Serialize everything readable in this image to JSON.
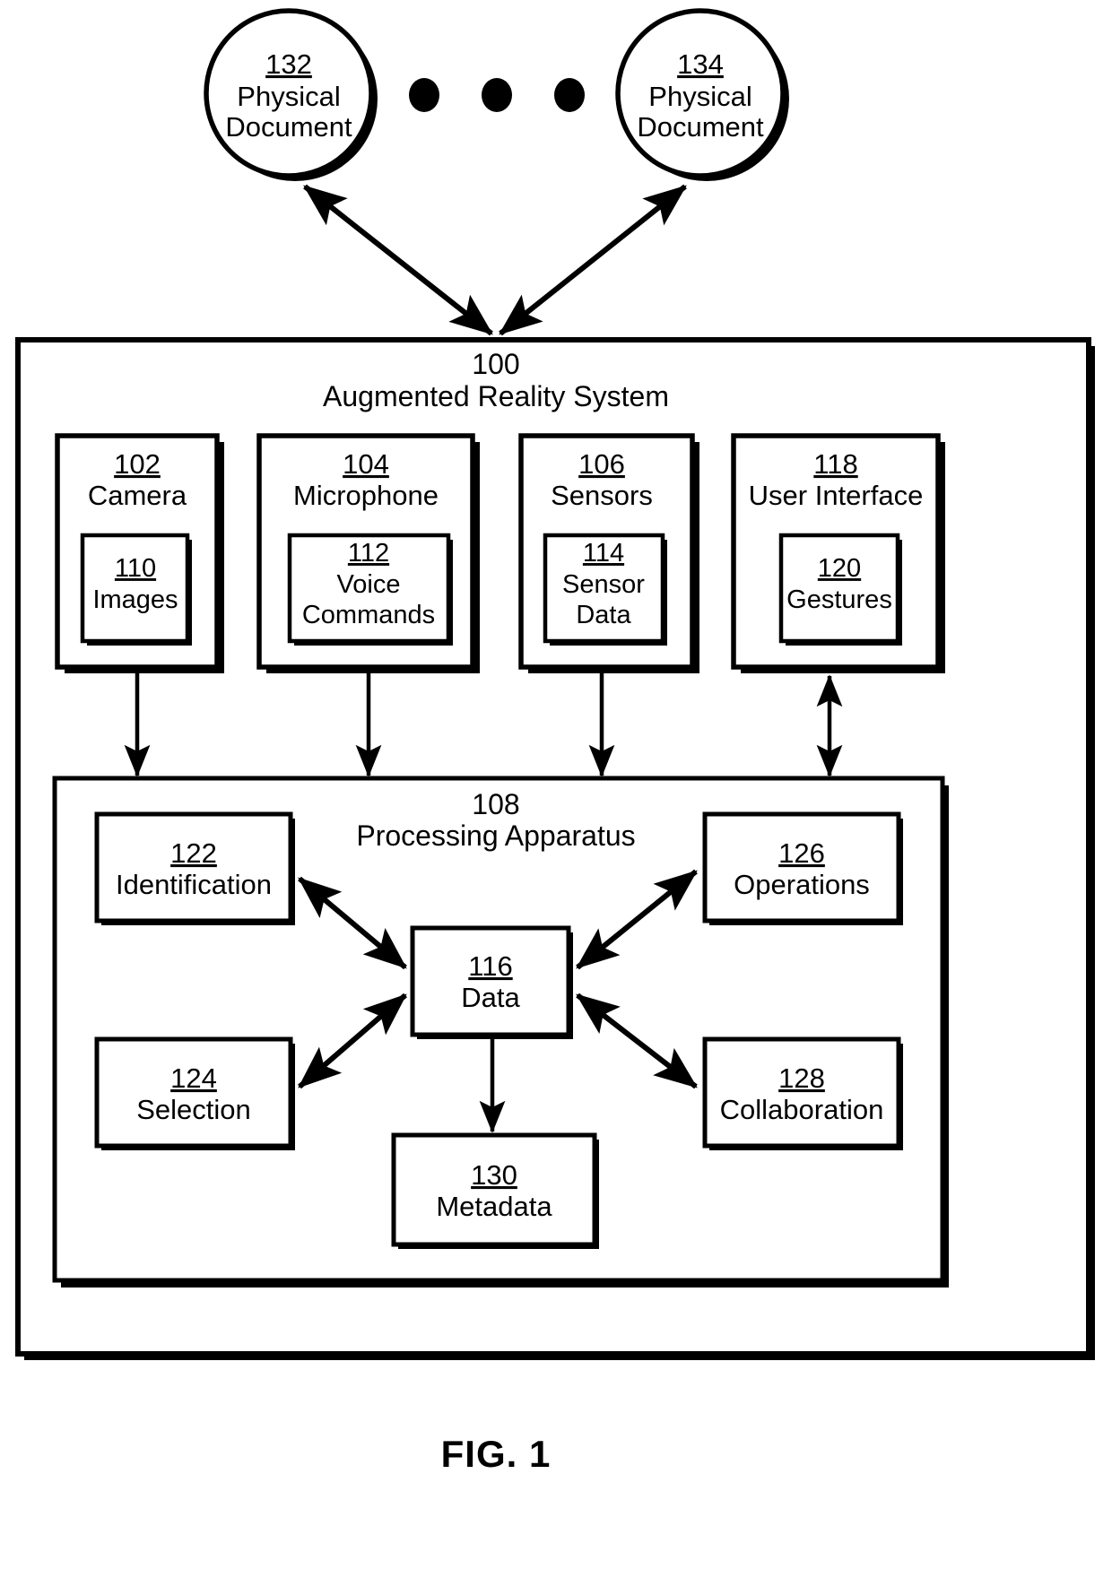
{
  "figure": {
    "caption": "FIG. 1",
    "title_ref": "100",
    "title_label": "Augmented Reality System"
  },
  "documents": [
    {
      "ref": "132",
      "line1": "Physical",
      "line2": "Document"
    },
    {
      "ref": "134",
      "line1": "Physical",
      "line2": "Document"
    }
  ],
  "ellipsis_dots": 3,
  "inputs": [
    {
      "ref": "102",
      "label": "Camera",
      "inner": {
        "ref": "110",
        "line1": "Images",
        "line2": ""
      }
    },
    {
      "ref": "104",
      "label": "Microphone",
      "inner": {
        "ref": "112",
        "line1": "Voice",
        "line2": "Commands"
      }
    },
    {
      "ref": "106",
      "label": "Sensors",
      "inner": {
        "ref": "114",
        "line1": "Sensor",
        "line2": "Data"
      }
    },
    {
      "ref": "118",
      "label": "User Interface",
      "inner": {
        "ref": "120",
        "line1": "Gestures",
        "line2": ""
      }
    }
  ],
  "processing": {
    "ref": "108",
    "label": "Processing Apparatus",
    "center": {
      "ref": "116",
      "label": "Data"
    },
    "modules": [
      {
        "ref": "122",
        "label": "Identification"
      },
      {
        "ref": "126",
        "label": "Operations"
      },
      {
        "ref": "124",
        "label": "Selection"
      },
      {
        "ref": "128",
        "label": "Collaboration"
      },
      {
        "ref": "130",
        "label": "Metadata"
      }
    ]
  },
  "colors": {
    "stroke": "#000000",
    "fill": "#ffffff",
    "shadow": "#000000"
  }
}
